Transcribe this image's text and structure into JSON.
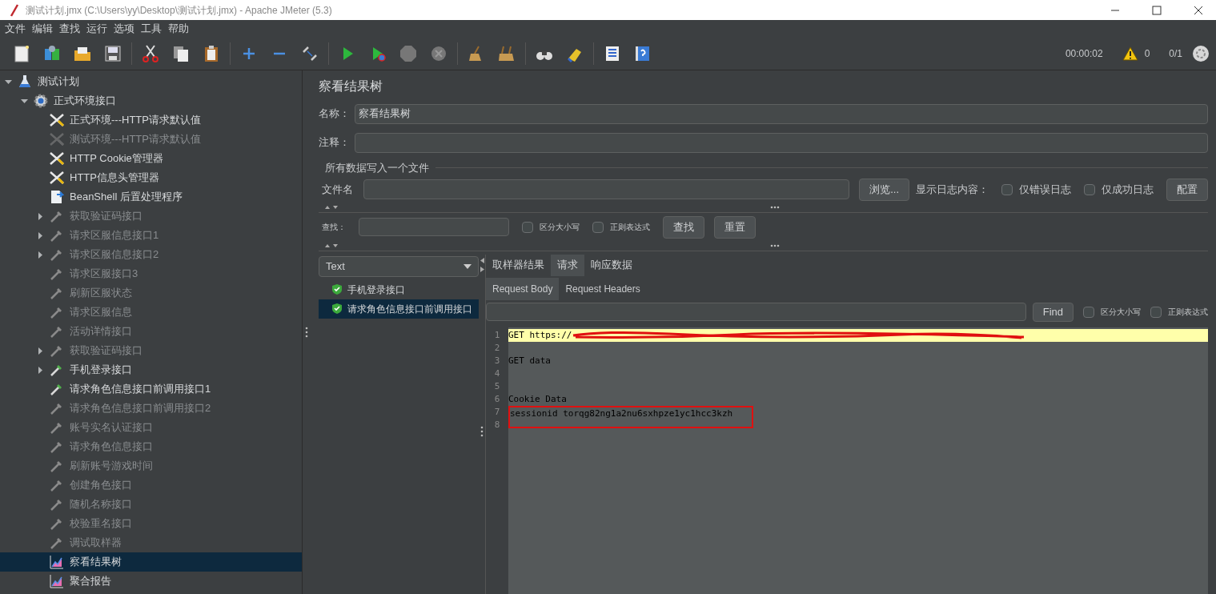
{
  "window": {
    "title": "测试计划.jmx (C:\\Users\\yy\\Desktop\\测试计划.jmx) - Apache JMeter (5.3)"
  },
  "menu": [
    "文件",
    "编辑",
    "查找",
    "运行",
    "选项",
    "工具",
    "帮助"
  ],
  "status": {
    "timer": "00:00:02",
    "warnings": "0",
    "threads": "0/1"
  },
  "tree": [
    {
      "label": "测试计划",
      "kind": "plan",
      "enabled": true,
      "selected": false,
      "expanded": true,
      "children": [
        {
          "label": "正式环境接口",
          "kind": "group",
          "enabled": true,
          "selected": false,
          "expanded": true,
          "children": [
            {
              "label": "正式环境---HTTP请求默认值",
              "kind": "config",
              "enabled": true,
              "selected": false
            },
            {
              "label": "测试环境---HTTP请求默认值",
              "kind": "config",
              "enabled": false,
              "selected": false
            },
            {
              "label": "HTTP Cookie管理器",
              "kind": "config",
              "enabled": true,
              "selected": false
            },
            {
              "label": "HTTP信息头管理器",
              "kind": "config",
              "enabled": true,
              "selected": false
            },
            {
              "label": "BeanShell 后置处理程序",
              "kind": "post",
              "enabled": true,
              "selected": false
            },
            {
              "label": "获取验证码接口",
              "kind": "sampler",
              "enabled": false,
              "selected": false,
              "expanded": false
            },
            {
              "label": "请求区服信息接口1",
              "kind": "sampler",
              "enabled": false,
              "selected": false,
              "expanded": false
            },
            {
              "label": "请求区服信息接口2",
              "kind": "sampler",
              "enabled": false,
              "selected": false,
              "expanded": false
            },
            {
              "label": "请求区服接口3",
              "kind": "sampler",
              "enabled": false,
              "selected": false
            },
            {
              "label": "刷新区服状态",
              "kind": "sampler",
              "enabled": false,
              "selected": false
            },
            {
              "label": "请求区服信息",
              "kind": "sampler",
              "enabled": false,
              "selected": false
            },
            {
              "label": "活动详情接口",
              "kind": "sampler",
              "enabled": false,
              "selected": false
            },
            {
              "label": "获取验证码接口",
              "kind": "sampler",
              "enabled": false,
              "selected": false,
              "expanded": false
            },
            {
              "label": "手机登录接口",
              "kind": "sampler",
              "enabled": true,
              "selected": false,
              "expanded": false
            },
            {
              "label": "请求角色信息接口前调用接口1",
              "kind": "sampler",
              "enabled": true,
              "selected": false
            },
            {
              "label": "请求角色信息接口前调用接口2",
              "kind": "sampler",
              "enabled": false,
              "selected": false
            },
            {
              "label": "账号实名认证接口",
              "kind": "sampler",
              "enabled": false,
              "selected": false
            },
            {
              "label": "请求角色信息接口",
              "kind": "sampler",
              "enabled": false,
              "selected": false
            },
            {
              "label": "刷新账号游戏时间",
              "kind": "sampler",
              "enabled": false,
              "selected": false
            },
            {
              "label": "创建角色接口",
              "kind": "sampler",
              "enabled": false,
              "selected": false
            },
            {
              "label": "随机名称接口",
              "kind": "sampler",
              "enabled": false,
              "selected": false
            },
            {
              "label": "校验重名接口",
              "kind": "sampler",
              "enabled": false,
              "selected": false
            },
            {
              "label": "调试取样器",
              "kind": "sampler",
              "enabled": false,
              "selected": false
            },
            {
              "label": "察看结果树",
              "kind": "listener",
              "enabled": true,
              "selected": true
            },
            {
              "label": "聚合报告",
              "kind": "listener",
              "enabled": true,
              "selected": false
            }
          ]
        }
      ]
    }
  ],
  "panel": {
    "title": "察看结果树",
    "name_label": "名称：",
    "name_value": "察看结果树",
    "comment_label": "注释：",
    "file_group": "所有数据写入一个文件",
    "file_label": "文件名",
    "browse": "浏览...",
    "log_label": "显示日志内容：",
    "log_options": [
      {
        "label": "仅错误日志",
        "checked": false
      },
      {
        "label": "仅成功日志",
        "checked": false
      }
    ],
    "config": "配置",
    "search_label": "查找：",
    "search_options": [
      {
        "label": "区分大小写",
        "checked": false
      },
      {
        "label": "正则表达式",
        "checked": false
      }
    ],
    "search_button": "查找",
    "reset_button": "重置"
  },
  "results": {
    "renderer": "Text",
    "items": [
      {
        "label": "手机登录接口",
        "selected": false
      },
      {
        "label": "请求角色信息接口前调用接口",
        "selected": true
      }
    ]
  },
  "tabs": [
    {
      "label": "取样器结果",
      "selected": false
    },
    {
      "label": "请求",
      "selected": true
    },
    {
      "label": "响应数据",
      "selected": false
    }
  ],
  "subtabs": [
    {
      "label": "Request Body",
      "selected": true
    },
    {
      "label": "Request Headers",
      "selected": false
    }
  ],
  "find": {
    "button": "Find",
    "options": [
      {
        "label": "区分大小写",
        "checked": false
      },
      {
        "label": "正则表达式",
        "checked": false
      }
    ]
  },
  "code": [
    {
      "no": "1",
      "text": "GET https://",
      "redacted": true,
      "highlighted": true,
      "boxed": false
    },
    {
      "no": "2"
    },
    {
      "no": "3",
      "text": "GET data",
      "redacted": false,
      "highlighted": false,
      "boxed": false
    },
    {
      "no": "4"
    },
    {
      "no": "5"
    },
    {
      "no": "6",
      "text": "Cookie Data",
      "redacted": false,
      "highlighted": false,
      "boxed": false
    },
    {
      "no": "7",
      "text": "sessionid torqg82ng1a2nu6sxhpze1yc1hcc3kzh",
      "redacted": false,
      "highlighted": false,
      "boxed": true
    },
    {
      "no": "8"
    }
  ]
}
